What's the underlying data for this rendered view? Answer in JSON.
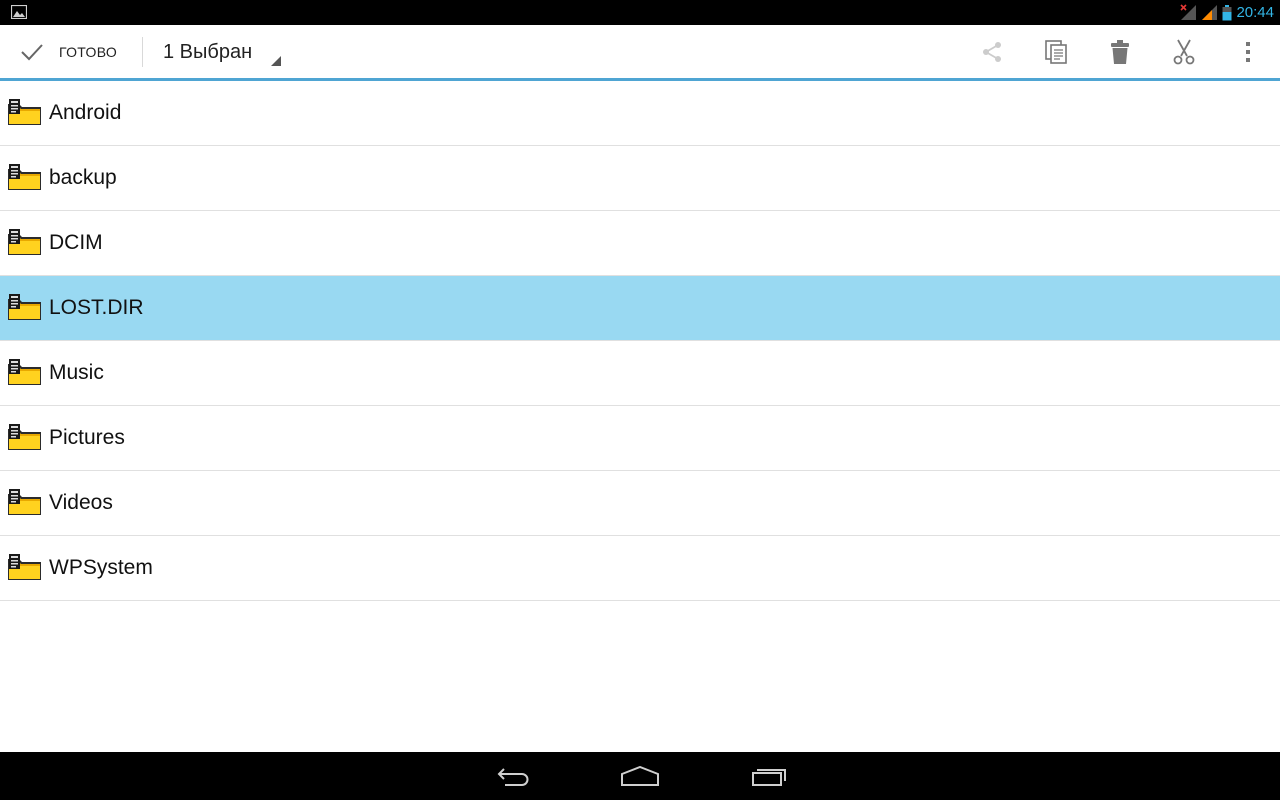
{
  "status_bar": {
    "time": "20:44",
    "notification_icon": "gallery-icon",
    "wifi_icon": "no-wifi-signal-icon",
    "signal_icon": "cell-signal-icon",
    "battery_icon": "battery-icon",
    "time_color": "#33b5e5"
  },
  "action_bar": {
    "done_label": "ГОТОВО",
    "selection_label": "1 Выбран",
    "actions": [
      "share-icon",
      "copy-icon",
      "delete-icon",
      "cut-icon",
      "overflow-menu-icon"
    ],
    "accent_color": "#4fa5d3"
  },
  "files": [
    {
      "name": "Android",
      "selected": false
    },
    {
      "name": "backup",
      "selected": false
    },
    {
      "name": "DCIM",
      "selected": false
    },
    {
      "name": "LOST.DIR",
      "selected": true
    },
    {
      "name": "Music",
      "selected": false
    },
    {
      "name": "Pictures",
      "selected": false
    },
    {
      "name": "Videos",
      "selected": false
    },
    {
      "name": "WPSystem",
      "selected": false
    }
  ],
  "selected_row_color": "#99d9f2",
  "nav_bar": {
    "buttons": [
      "back-icon",
      "home-icon",
      "recent-apps-icon"
    ]
  }
}
